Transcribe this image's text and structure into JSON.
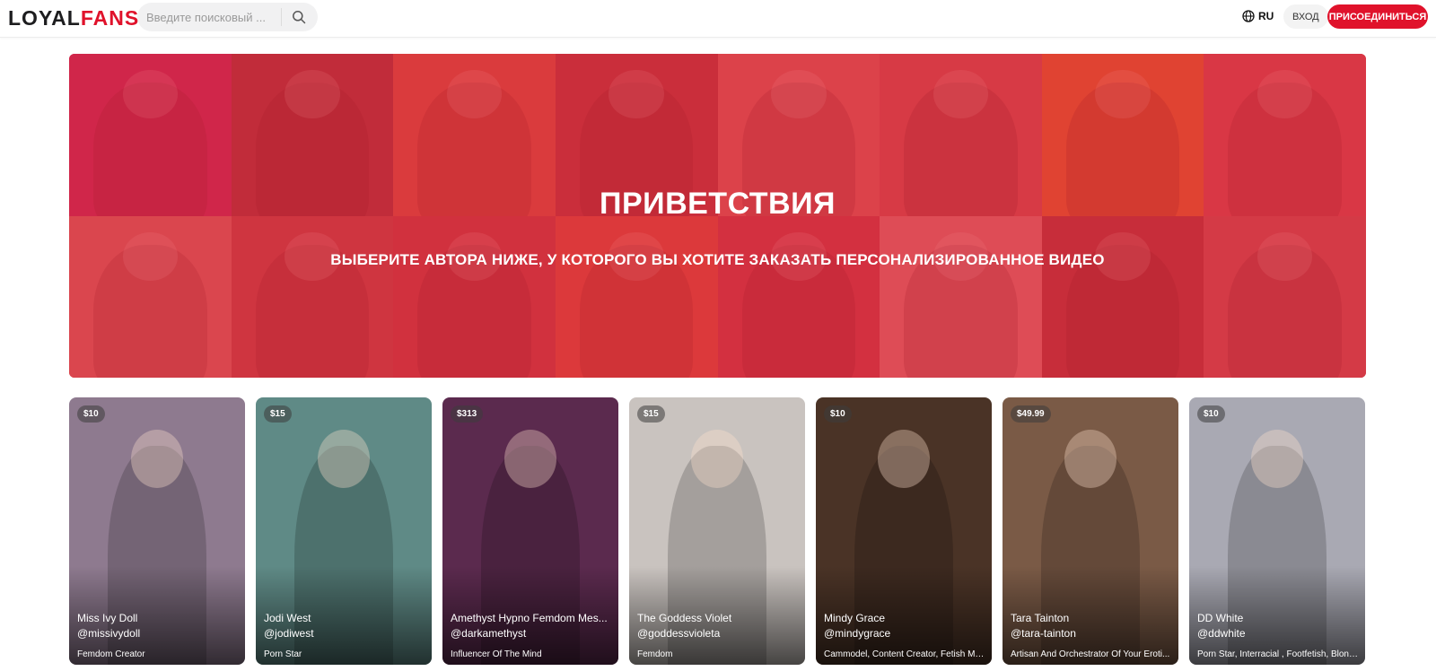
{
  "header": {
    "logo_part1": "LOYAL",
    "logo_part2": "FANS",
    "search_placeholder": "Введите поисковый ...",
    "language": "RU",
    "login_label": "ВХОД",
    "join_label": "ПРИСОЕДИНИТЬСЯ"
  },
  "hero": {
    "title": "ПРИВЕТСТВИЯ",
    "subtitle": "ВЫБЕРИТЕ АВТОРА НИЖЕ, У КОТОРОГО ВЫ ХОТИТЕ ЗАКАЗАТЬ ПЕРСОНАЛИЗИРОВАННОЕ ВИДЕО"
  },
  "creators": [
    {
      "price": "$10",
      "name": "Miss Ivy Doll",
      "handle": "@missivydoll",
      "category": "Femdom Creator",
      "bg": "#8e7a8f"
    },
    {
      "price": "$15",
      "name": "Jodi West",
      "handle": "@jodiwest",
      "category": "Porn Star",
      "bg": "#5f8a86"
    },
    {
      "price": "$313",
      "name": "Amethyst Hypno Femdom Mes...",
      "handle": "@darkamethyst",
      "category": "Influencer Of The Mind",
      "bg": "#5b2a4e"
    },
    {
      "price": "$15",
      "name": "The Goddess Violet",
      "handle": "@goddessvioleta",
      "category": "Femdom",
      "bg": "#c9c3bf"
    },
    {
      "price": "$10",
      "name": "Mindy Grace",
      "handle": "@mindygrace",
      "category": "Cammodel, Content Creator, Fetish Mo...",
      "bg": "#4a3326"
    },
    {
      "price": "$49.99",
      "name": "Tara Tainton",
      "handle": "@tara-tainton",
      "category": "Artisan And Orchestrator Of Your Eroti...",
      "bg": "#7a5a46"
    },
    {
      "price": "$10",
      "name": "DD White",
      "handle": "@ddwhite",
      "category": "Porn Star, Interracial , Footfetish, Blond...",
      "bg": "#a9a9b3"
    }
  ]
}
